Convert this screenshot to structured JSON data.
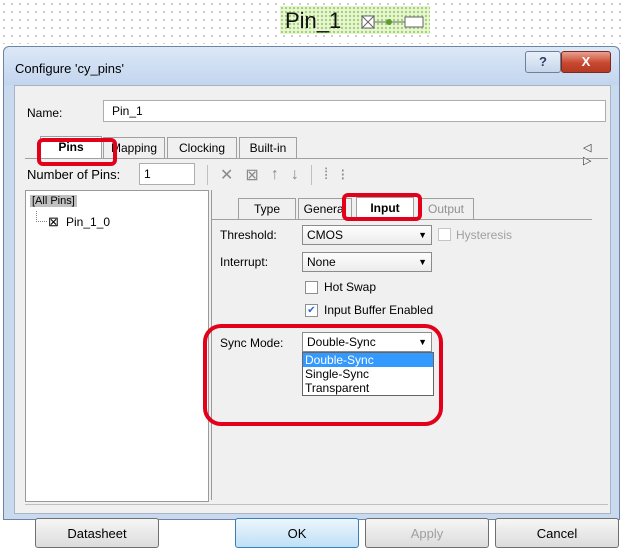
{
  "canvas": {
    "component_name": "Pin_1"
  },
  "dialog": {
    "title": "Configure 'cy_pins'",
    "help_label": "?",
    "close_label": "X",
    "name_label": "Name:",
    "name_value": "Pin_1",
    "tabs": [
      {
        "label": "Pins",
        "active": true
      },
      {
        "label": "Mapping"
      },
      {
        "label": "Clocking"
      },
      {
        "label": "Built-in"
      }
    ],
    "tab_arrows": "◁ ▷",
    "pins_panel": {
      "num_pins_label": "Number of Pins:",
      "num_pins_value": "1",
      "tree_root": "[All Pins]",
      "tree_pin": "Pin_1_0",
      "subtabs": [
        {
          "label": "Type"
        },
        {
          "label": "General"
        },
        {
          "label": "Input",
          "active": true
        },
        {
          "label": "Output",
          "disabled": true
        }
      ],
      "threshold_label": "Threshold:",
      "threshold_value": "CMOS",
      "hysteresis_label": "Hysteresis",
      "interrupt_label": "Interrupt:",
      "interrupt_value": "None",
      "hot_swap_label": "Hot Swap",
      "input_buffer_label": "Input Buffer Enabled",
      "sync_mode_label": "Sync Mode:",
      "sync_mode_value": "Double-Sync",
      "sync_options": [
        "Double-Sync",
        "Single-Sync",
        "Transparent"
      ]
    },
    "buttons": {
      "datasheet": "Datasheet",
      "ok": "OK",
      "apply": "Apply",
      "cancel": "Cancel"
    }
  },
  "colors": {
    "highlight": "#e3001b",
    "selection": "#3399ff",
    "titlebar": "#c3d5ee"
  }
}
